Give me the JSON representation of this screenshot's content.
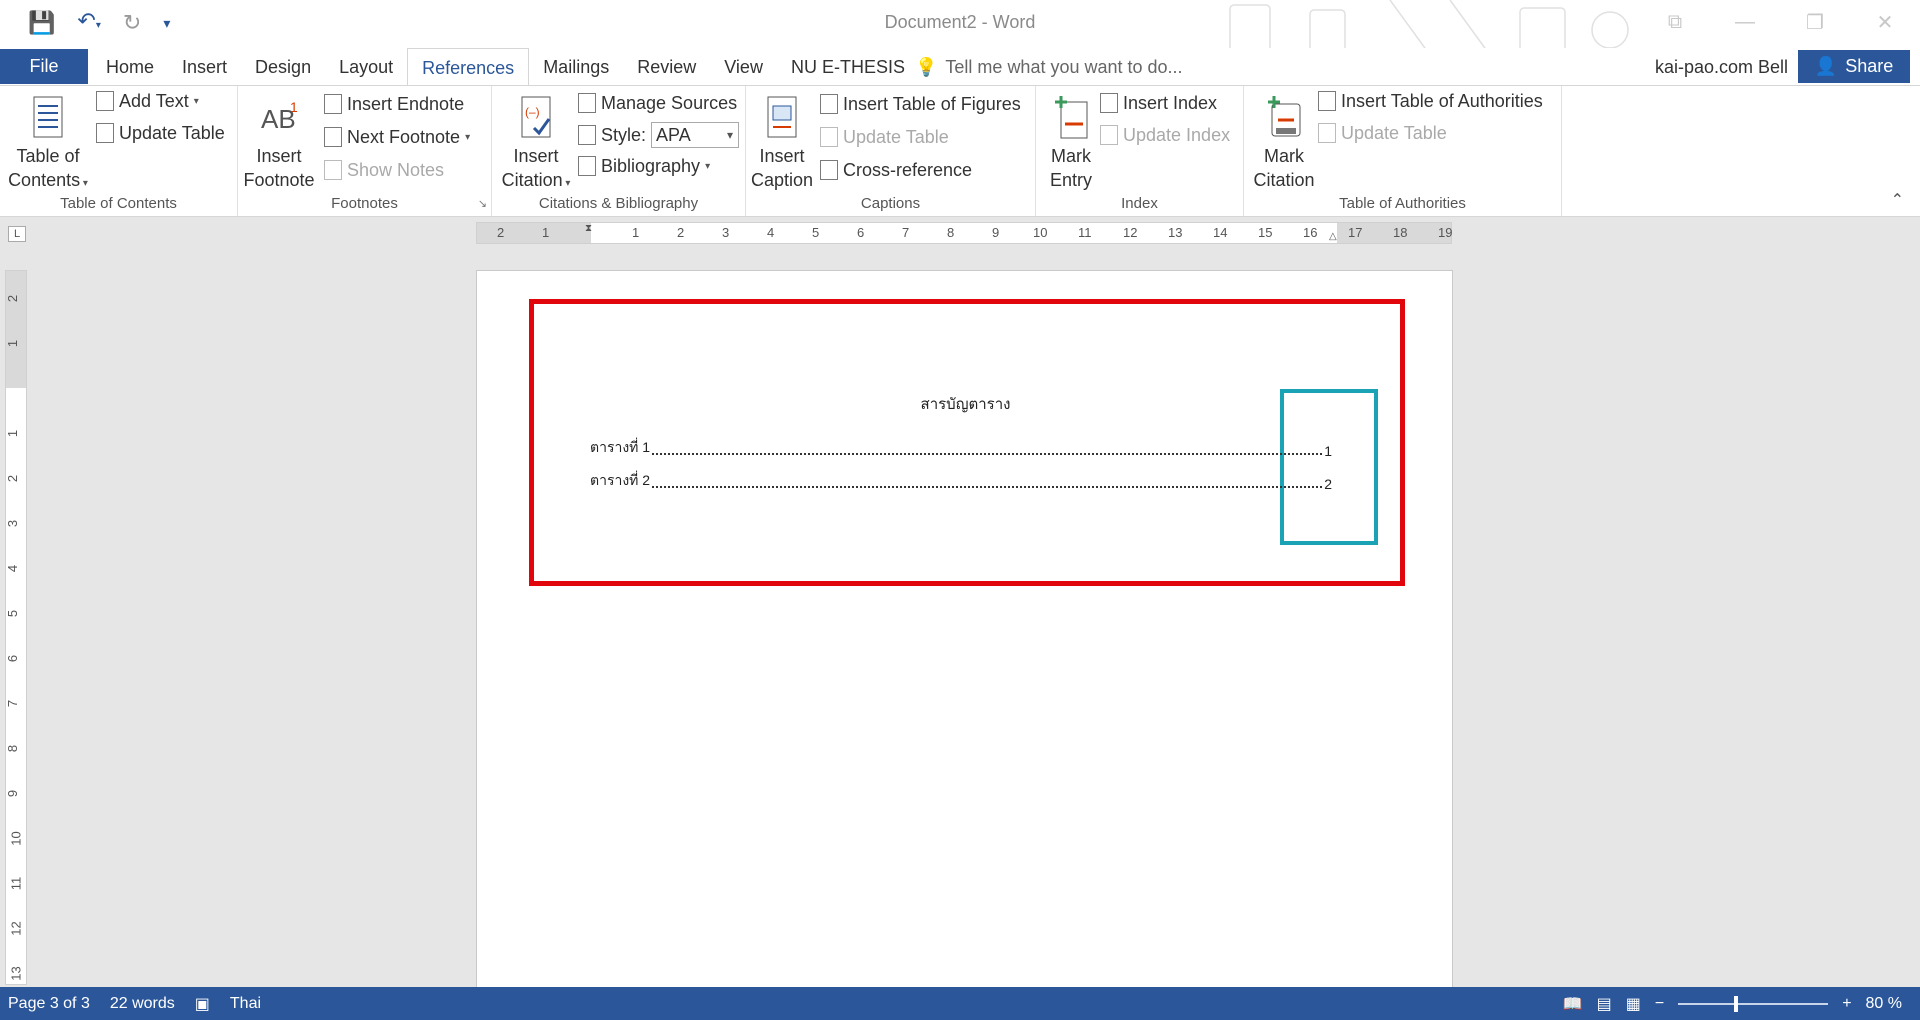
{
  "window": {
    "title": "Document2 - Word",
    "account": "kai-pao.com Bell",
    "share_label": "Share"
  },
  "tabs": {
    "file": "File",
    "items": [
      "Home",
      "Insert",
      "Design",
      "Layout",
      "References",
      "Mailings",
      "Review",
      "View",
      "NU E-THESIS"
    ],
    "active": "References",
    "tell_me": "Tell me what you want to do..."
  },
  "ribbon": {
    "toc": {
      "big_label_1": "Table of",
      "big_label_2": "Contents",
      "add_text": "Add Text",
      "update_table": "Update Table",
      "group": "Table of Contents"
    },
    "footnotes": {
      "insert_footnote_1": "Insert",
      "insert_footnote_2": "Footnote",
      "insert_endnote": "Insert Endnote",
      "next_footnote": "Next Footnote",
      "show_notes": "Show Notes",
      "group": "Footnotes"
    },
    "citations": {
      "insert_citation_1": "Insert",
      "insert_citation_2": "Citation",
      "manage_sources": "Manage Sources",
      "style_label": "Style:",
      "style_value": "APA",
      "bibliography": "Bibliography",
      "group": "Citations & Bibliography"
    },
    "captions": {
      "insert_caption_1": "Insert",
      "insert_caption_2": "Caption",
      "insert_tof": "Insert Table of Figures",
      "update_table": "Update Table",
      "cross_reference": "Cross-reference",
      "group": "Captions"
    },
    "index": {
      "mark_entry_1": "Mark",
      "mark_entry_2": "Entry",
      "insert_index": "Insert Index",
      "update_index": "Update Index",
      "group": "Index"
    },
    "toa": {
      "mark_citation_1": "Mark",
      "mark_citation_2": "Citation",
      "insert_toa": "Insert Table of Authorities",
      "update_table": "Update Table",
      "group": "Table of Authorities"
    }
  },
  "document": {
    "heading": "สารบัญตาราง",
    "entries": [
      {
        "label": "ตารางที่ 1",
        "page": "1"
      },
      {
        "label": "ตารางที่ 2",
        "page": "2"
      }
    ]
  },
  "status": {
    "page": "Page 3 of 3",
    "words": "22 words",
    "language": "Thai",
    "zoom": "80 %"
  },
  "colors": {
    "accent": "#2b579a",
    "highlight_red": "#e0060c",
    "highlight_teal": "#1aa3b5"
  }
}
